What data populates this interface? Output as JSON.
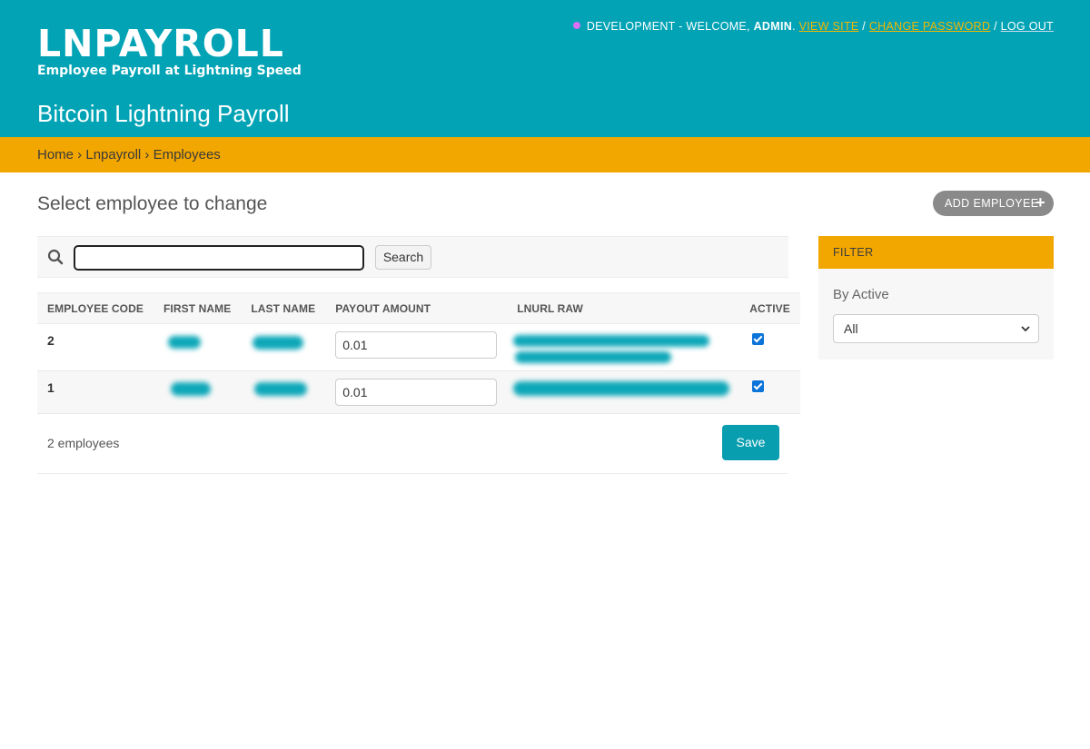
{
  "header": {
    "logo_title": "LNPAYROLL",
    "logo_subtitle": "Employee Payroll at Lightning Speed",
    "site_name": "Bitcoin Lightning Payroll",
    "env_dot_color": "#d770f2",
    "user_tools": {
      "prefix": "DEVELOPMENT - WELCOME, ",
      "username": "ADMIN",
      "after_username": ". ",
      "view_site": "VIEW SITE",
      "sep1": " / ",
      "change_password": "CHANGE PASSWORD",
      "sep2": " / ",
      "log_out": "LOG OUT"
    }
  },
  "breadcrumbs": {
    "home": "Home",
    "sep": " › ",
    "app": "Lnpayroll",
    "current": "Employees"
  },
  "main": {
    "title": "Select employee to change",
    "add_button": "ADD EMPLOYEE",
    "search": {
      "value": "",
      "button": "Search"
    },
    "table": {
      "columns": [
        "EMPLOYEE CODE",
        "FIRST NAME",
        "LAST NAME",
        "PAYOUT AMOUNT",
        "LNURL RAW",
        "ACTIVE"
      ],
      "rows": [
        {
          "code": "2",
          "payout": "0.01",
          "active": true
        },
        {
          "code": "1",
          "payout": "0.01",
          "active": true
        }
      ]
    },
    "count": "2 employees",
    "save_button": "Save"
  },
  "filter": {
    "title": "FILTER",
    "subtitle": "By Active",
    "selected": "All"
  },
  "colors": {
    "header": "#01a3b5",
    "accent": "#f2a700",
    "save": "#089eaf"
  }
}
